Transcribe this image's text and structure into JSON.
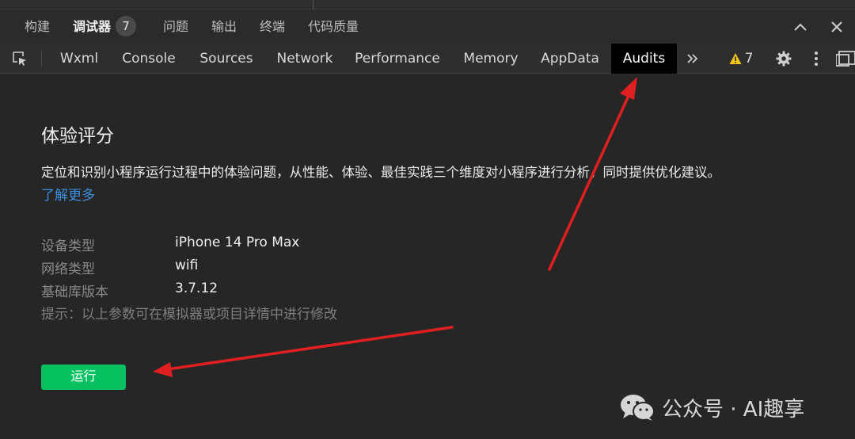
{
  "panel_tabs": [
    {
      "label": "构建",
      "active": false
    },
    {
      "label": "调试器",
      "active": true,
      "badge": "7"
    },
    {
      "label": "问题",
      "active": false
    },
    {
      "label": "输出",
      "active": false
    },
    {
      "label": "终端",
      "active": false
    },
    {
      "label": "代码质量",
      "active": false
    }
  ],
  "toolbar": {
    "tabs": [
      {
        "label": "Wxml"
      },
      {
        "label": "Console"
      },
      {
        "label": "Sources"
      },
      {
        "label": "Network"
      },
      {
        "label": "Performance"
      },
      {
        "label": "Memory"
      },
      {
        "label": "AppData"
      },
      {
        "label": "Audits",
        "active": true
      }
    ],
    "warning_count": "7",
    "icons": [
      "inspect-icon",
      "more-tabs-icon",
      "warning-icon",
      "gear-icon",
      "kebab-icon",
      "dock-icon"
    ]
  },
  "audits": {
    "title": "体验评分",
    "description": "定位和识别小程序运行过程中的体验问题，从性能、体验、最佳实践三个维度对小程序进行分析，同时提供优化建议。",
    "learn_more": "了解更多",
    "params": [
      {
        "label": "设备类型",
        "value": "iPhone 14 Pro Max"
      },
      {
        "label": "网络类型",
        "value": "wifi"
      },
      {
        "label": "基础库版本",
        "value": "3.7.12"
      }
    ],
    "hint": "提示：以上参数可在模拟器或项目详情中进行修改",
    "run_label": "运行"
  },
  "watermark": {
    "text": "公众号 · AI趣享"
  },
  "colors": {
    "accent_green": "#07c160",
    "link_blue": "#3b8fe0",
    "arrow_red": "#e02020",
    "active_tab_bg": "#000000"
  }
}
